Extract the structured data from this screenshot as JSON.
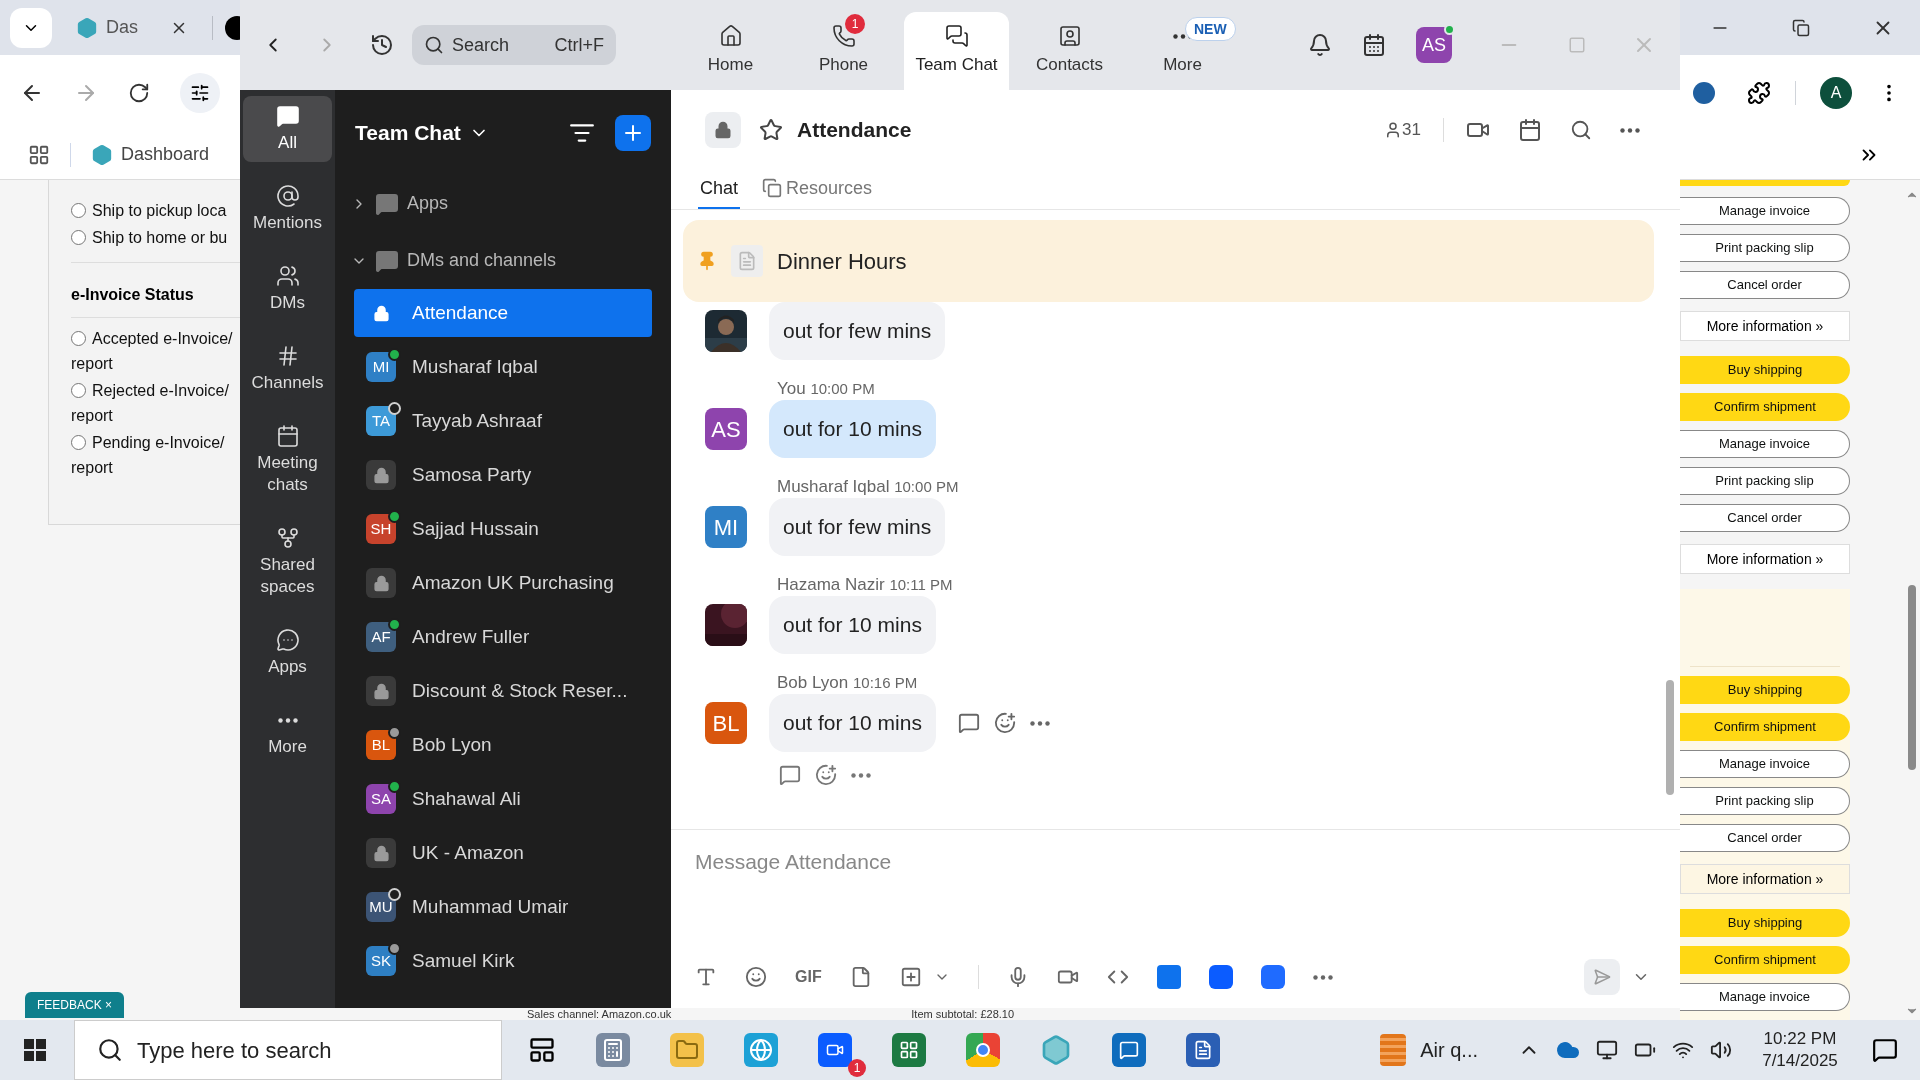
{
  "browser": {
    "tabs": [
      {
        "label": "Das",
        "selected": true
      }
    ],
    "bookmark": {
      "label": "Dashboard"
    },
    "profile_initial": "A",
    "page_left": {
      "delivery_options": [
        {
          "label": "Ship to pickup loca",
          "selected": false
        },
        {
          "label": "Ship to home or bu",
          "selected": false
        }
      ],
      "einvoice_title": "e-Invoice Status",
      "einvoice_options": [
        {
          "label": "Accepted e-Invoice/",
          "label_line2": "report",
          "selected": false
        },
        {
          "label": "Rejected e-Invoice/",
          "label_line2": "report",
          "selected": false
        },
        {
          "label": "Pending e-Invoice/",
          "label_line2": "report",
          "selected": false
        }
      ]
    },
    "footer_texts": [
      "Sales channel: Amazon.co.uk",
      "Item subtotal: £28.10"
    ],
    "action_groups": [
      {
        "highlighted": false,
        "blank_above": false,
        "actions": [
          {
            "label": "Manage invoice",
            "kind": "secondary"
          },
          {
            "label": "Print packing slip",
            "kind": "secondary"
          },
          {
            "label": "Cancel order",
            "kind": "secondary"
          }
        ],
        "more": "More information »"
      },
      {
        "highlighted": false,
        "blank_above": false,
        "actions": [
          {
            "label": "Buy shipping",
            "kind": "primary"
          },
          {
            "label": "Confirm shipment",
            "kind": "primary"
          },
          {
            "label": "Manage invoice",
            "kind": "secondary"
          },
          {
            "label": "Print packing slip",
            "kind": "secondary"
          },
          {
            "label": "Cancel order",
            "kind": "secondary"
          }
        ],
        "more": "More information »"
      },
      {
        "highlighted": true,
        "blank_above": true,
        "actions": [
          {
            "label": "Buy shipping",
            "kind": "primary"
          },
          {
            "label": "Confirm shipment",
            "kind": "primary"
          },
          {
            "label": "Manage invoice",
            "kind": "secondary"
          },
          {
            "label": "Print packing slip",
            "kind": "secondary"
          },
          {
            "label": "Cancel order",
            "kind": "secondary"
          }
        ],
        "more": "More information »"
      },
      {
        "highlighted": true,
        "blank_above": false,
        "actions": [
          {
            "label": "Buy shipping",
            "kind": "primary"
          },
          {
            "label": "Confirm shipment",
            "kind": "primary"
          },
          {
            "label": "Manage invoice",
            "kind": "secondary"
          }
        ]
      }
    ],
    "feedback": {
      "label": "FEEDBACK",
      "close": "×"
    }
  },
  "zoom_app": {
    "nav": {
      "search": {
        "placeholder": "Search",
        "shortcut": "Ctrl+F"
      },
      "tabs": [
        {
          "label": "Home",
          "selected": false
        },
        {
          "label": "Phone",
          "badge": "1",
          "selected": false
        },
        {
          "label": "Team Chat",
          "selected": true
        },
        {
          "label": "Contacts",
          "selected": false
        },
        {
          "label": "More",
          "tag": "NEW",
          "selected": false
        }
      ],
      "user_initials": "AS"
    },
    "rail": [
      {
        "label": "All",
        "selected": true
      },
      {
        "label": "Mentions",
        "selected": false
      },
      {
        "label": "DMs",
        "selected": false
      },
      {
        "label": "Channels",
        "selected": false
      },
      {
        "label": "Meeting chats",
        "selected": false
      },
      {
        "label": "Shared spaces",
        "selected": false
      },
      {
        "label": "Apps",
        "selected": false
      },
      {
        "label": "More",
        "selected": false
      }
    ],
    "sidebar": {
      "title": "Team Chat",
      "sections": [
        {
          "label": "Apps",
          "expanded": false
        },
        {
          "label": "DMs and channels",
          "expanded": true
        }
      ],
      "items": [
        {
          "kind": "channel",
          "name": "Attendance",
          "selected": true
        },
        {
          "kind": "dm",
          "name": "Musharaf Iqbal",
          "initials": "MI",
          "color": "#2f80c6",
          "online": true,
          "away": false,
          "selected": false
        },
        {
          "kind": "dm",
          "name": "Tayyab Ashraaf",
          "initials": "TA",
          "color": "#3d9ad8",
          "online": false,
          "away": false,
          "selected": false
        },
        {
          "kind": "channel",
          "name": "Samosa Party",
          "selected": false
        },
        {
          "kind": "dm",
          "name": "Sajjad Hussain",
          "initials": "SH",
          "color": "#c7432c",
          "online": true,
          "away": false,
          "selected": false
        },
        {
          "kind": "channel",
          "name": "Amazon UK Purchasing",
          "selected": false
        },
        {
          "kind": "dm",
          "name": "Andrew Fuller",
          "initials": "AF",
          "color": "#3f5f7f",
          "online": true,
          "away": false,
          "selected": false
        },
        {
          "kind": "channel",
          "name": "Discount & Stock Reser...",
          "selected": false
        },
        {
          "kind": "dm",
          "name": "Bob Lyon",
          "initials": "BL",
          "color": "#d9560e",
          "online": false,
          "away": true,
          "selected": false
        },
        {
          "kind": "dm",
          "name": "Shahawal Ali",
          "initials": "SA",
          "color": "#8e44ad",
          "online": true,
          "away": false,
          "selected": false
        },
        {
          "kind": "channel",
          "name": "UK - Amazon",
          "selected": false
        },
        {
          "kind": "dm",
          "name": "Muhammad Umair",
          "initials": "MU",
          "color": "#3c5475",
          "online": false,
          "away": false,
          "selected": false
        },
        {
          "kind": "dm",
          "name": "Samuel Kirk",
          "initials": "SK",
          "color": "#2e7fc3",
          "online": false,
          "away": true,
          "selected": false
        }
      ]
    },
    "chat": {
      "title": "Attendance",
      "member_count": "31",
      "tabs": [
        {
          "label": "Chat",
          "selected": true
        },
        {
          "label": "Resources",
          "selected": false
        }
      ],
      "pinned": {
        "title": "Dinner Hours"
      },
      "messages": [
        {
          "text": "out for few mins",
          "own": false,
          "hovered": false
        },
        {
          "sender": "You",
          "time": "10:00 PM",
          "avatar": {
            "kind": "initials",
            "initials": "AS",
            "color": "#8e44ad"
          },
          "text": "out for 10 mins",
          "own": true,
          "hovered": false
        },
        {
          "sender": "Musharaf Iqbal",
          "time": "10:00 PM",
          "avatar": {
            "kind": "initials",
            "initials": "MI",
            "color": "#2f80c6"
          },
          "text": "out for few mins",
          "own": false,
          "hovered": false
        },
        {
          "sender": "Hazama Nazir",
          "time": "10:11 PM",
          "text": "out for 10 mins",
          "own": false,
          "hovered": false
        },
        {
          "sender": "Bob Lyon",
          "time": "10:16 PM",
          "avatar": {
            "kind": "initials",
            "initials": "BL",
            "color": "#d9560e"
          },
          "text": "out for 10 mins",
          "own": false,
          "hovered": true
        }
      ],
      "composer": {
        "placeholder": "Message Attendance",
        "gif_label": "GIF"
      }
    }
  },
  "taskbar": {
    "search_placeholder": "Type here to search",
    "zoom_badge": "1",
    "weather": "Air q...",
    "time": "10:22 PM",
    "date": "7/14/2025"
  }
}
